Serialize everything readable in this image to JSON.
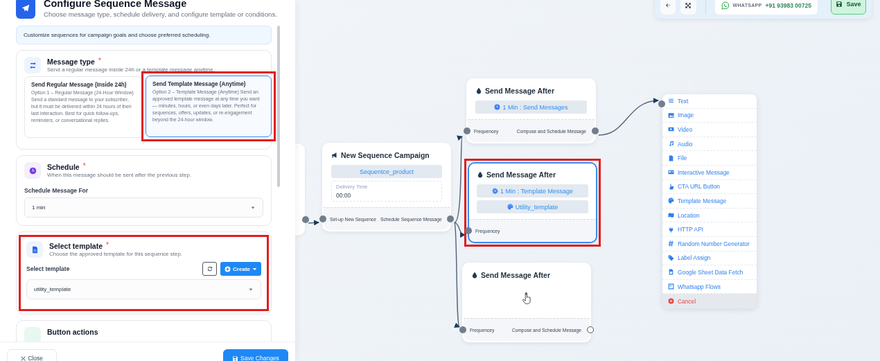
{
  "panel": {
    "title": "Configure Sequence Message",
    "subtitle": "Choose message type, schedule delivery, and configure template or conditions.",
    "info": "Customize sequences for campaign goals and choose preferred scheduling.",
    "message_type": {
      "title": "Message type",
      "required_mark": "*",
      "subtitle": "Send a regular message inside 24h or a template message anytime.",
      "options": [
        {
          "title": "Send Regular Message (Inside 24h)",
          "description": "Option 1 – Regular Message (24-Hour Window) Send a standard message to your subscriber, but it must be delivered within 24 hours of their last interaction. Best for quick follow-ups, reminders, or conversational replies.",
          "selected": false,
          "highlighted": false
        },
        {
          "title": "Send Template Message (Anytime)",
          "description": "Option 2 – Template Message (Anytime) Send an approved template message at any time you want — minutes, hours, or even days later. Perfect for sequences, offers, updates, or re-engagement beyond the 24-hour window.",
          "selected": true,
          "highlighted": true
        }
      ]
    },
    "schedule": {
      "title": "Schedule",
      "required_mark": "*",
      "subtitle": "When this message should be sent after the previous step.",
      "field_label": "Schedule Message For",
      "value": "1 min"
    },
    "template": {
      "title": "Select template",
      "required_mark": "*",
      "subtitle": "Choose the approved template for this sequence step.",
      "field_label": "Select template",
      "create_label": "Create",
      "value": "utility_template",
      "highlighted": true
    },
    "button_actions": {
      "title": "Button actions"
    },
    "footer": {
      "close": "Close",
      "save": "Save Changes"
    }
  },
  "toolbar": {
    "channel": "WHATSAPP",
    "phone": "+91 93983 00725",
    "save": "Save"
  },
  "nodes": [
    {
      "kind": "campaign",
      "title": "New Sequence Campaign",
      "selected": false,
      "highlighted": false,
      "pills": [
        {
          "kind": "plain",
          "text": "Sequentce_product"
        }
      ],
      "delivery_label": "Delivery Time",
      "delivery_value": "00:00",
      "input_label": "Set-up New Sequence",
      "output_label": "Schedule Sequence Message",
      "output_connected": true
    },
    {
      "kind": "delay",
      "title": "Send Message After",
      "selected": false,
      "highlighted": false,
      "pills": [
        {
          "kind": "schedule",
          "text": "1 Min : Send Messages"
        }
      ],
      "input_label": "Frequencey",
      "output_label": "Compose and Schedule Message",
      "output_connected": true
    },
    {
      "kind": "delay",
      "title": "Send Message After",
      "selected": true,
      "highlighted": true,
      "pills": [
        {
          "kind": "template",
          "text": "1 Min : Template Message"
        },
        {
          "kind": "template_name",
          "text": "Utility_template"
        }
      ],
      "input_label": "Frequencey"
    },
    {
      "kind": "empty",
      "title": "Send Message After",
      "selected": false,
      "highlighted": false,
      "input_label": "Frequencey",
      "output_label": "Compose and Schedule Message",
      "output_connected": false
    }
  ],
  "menu": {
    "items": [
      {
        "kind": "text",
        "label": "Text"
      },
      {
        "kind": "image",
        "label": "Image"
      },
      {
        "kind": "video",
        "label": "Video"
      },
      {
        "kind": "audio",
        "label": "Audio"
      },
      {
        "kind": "file",
        "label": "File"
      },
      {
        "kind": "interactive",
        "label": "Interactive Message"
      },
      {
        "kind": "cta",
        "label": "CTA URL Button"
      },
      {
        "kind": "template",
        "label": "Template Message"
      },
      {
        "kind": "location",
        "label": "Location"
      },
      {
        "kind": "http",
        "label": "HTTP API"
      },
      {
        "kind": "random",
        "label": "Random Number Generator"
      },
      {
        "kind": "label",
        "label": "Label Assign"
      },
      {
        "kind": "sheet",
        "label": "Google Sheet Data Fetch"
      },
      {
        "kind": "flows",
        "label": "Whatsapp Flows"
      },
      {
        "kind": "cancel",
        "label": "Cancel"
      }
    ]
  }
}
